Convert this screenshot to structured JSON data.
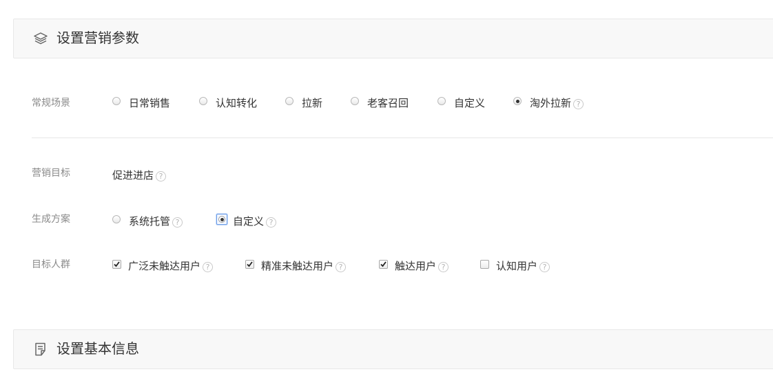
{
  "section_marketing": {
    "title": "设置营销参数",
    "icon": "layers-icon"
  },
  "scene": {
    "label": "常规场景",
    "options": [
      {
        "label": "日常销售",
        "checked": false
      },
      {
        "label": "认知转化",
        "checked": false
      },
      {
        "label": "拉新",
        "checked": false
      },
      {
        "label": "老客召回",
        "checked": false
      },
      {
        "label": "自定义",
        "checked": false
      },
      {
        "label": "淘外拉新",
        "checked": true,
        "help": "?"
      }
    ]
  },
  "goal": {
    "label": "营销目标",
    "value": "促进进店",
    "help": "?"
  },
  "plan": {
    "label": "生成方案",
    "options": [
      {
        "label": "系统托管",
        "checked": false,
        "help": "?"
      },
      {
        "label": "自定义",
        "checked": true,
        "help": "?"
      }
    ]
  },
  "audience": {
    "label": "目标人群",
    "options": [
      {
        "label": "广泛未触达用户",
        "checked": true,
        "help": "?"
      },
      {
        "label": "精准未触达用户",
        "checked": true,
        "help": "?"
      },
      {
        "label": "触达用户",
        "checked": true,
        "help": "?"
      },
      {
        "label": "认知用户",
        "checked": false,
        "help": "?"
      }
    ]
  },
  "section_basic": {
    "title": "设置基本信息",
    "icon": "document-icon"
  }
}
